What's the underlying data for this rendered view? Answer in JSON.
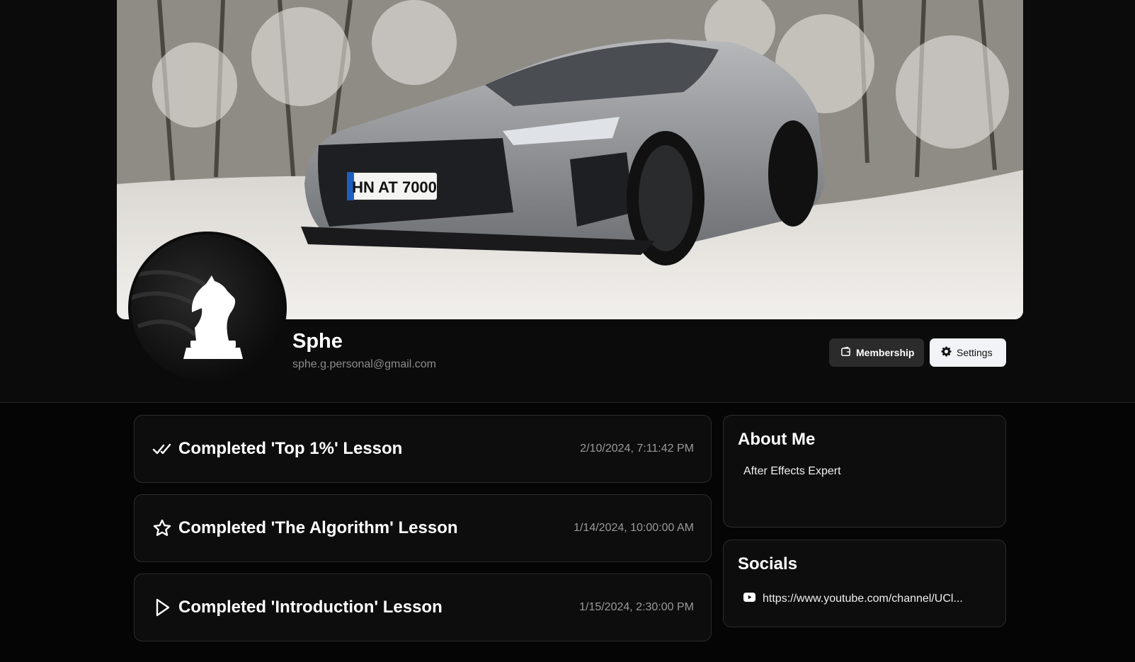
{
  "profile": {
    "name": "Sphe",
    "email": "sphe.g.personal@gmail.com"
  },
  "actions": {
    "membership_label": "Membership",
    "settings_label": "Settings"
  },
  "activities": [
    {
      "icon": "double-check-icon",
      "title": "Completed 'Top 1%' Lesson",
      "time": "2/10/2024, 7:11:42 PM"
    },
    {
      "icon": "star-icon",
      "title": "Completed 'The Algorithm' Lesson",
      "time": "1/14/2024, 10:00:00 AM"
    },
    {
      "icon": "play-icon",
      "title": "Completed 'Introduction' Lesson",
      "time": "1/15/2024, 2:30:00 PM"
    }
  ],
  "about": {
    "title": "About Me",
    "text": "After Effects Expert"
  },
  "socials": {
    "title": "Socials",
    "links": [
      {
        "icon": "youtube-icon",
        "url": "https://www.youtube.com/channel/UCl..."
      }
    ]
  },
  "banner": {
    "plate_text": "HN AT 7000"
  },
  "colors": {
    "background": "#050505",
    "card": "#0d0d0d",
    "border": "#2c2c2c",
    "membership_button": "#2b2b2b",
    "settings_button": "#f1f3f6"
  }
}
